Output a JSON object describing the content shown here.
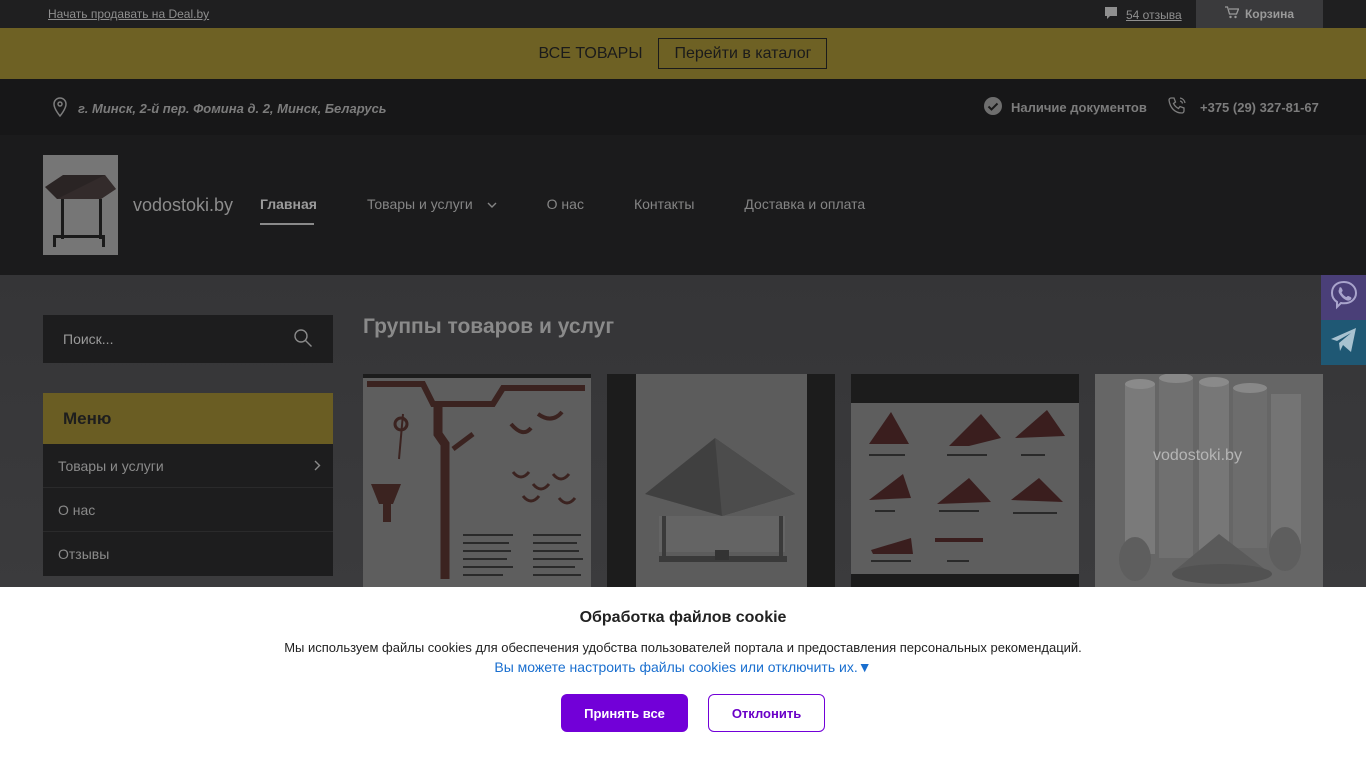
{
  "topbar": {
    "sell_link": "Начать продавать на Deal.by",
    "reviews_label": "54 отзыва",
    "cart_label": "Корзина"
  },
  "promo": {
    "all_goods": "ВСЕ ТОВАРЫ",
    "catalog_button": "Перейти в каталог"
  },
  "infobar": {
    "address": "г. Минск, 2-й пер. Фомина д. 2, Минск, Беларусь",
    "documents": "Наличие документов",
    "phone": "+375 (29) 327-81-67"
  },
  "header": {
    "site_name": "vodostoki.by",
    "nav": [
      {
        "label": "Главная"
      },
      {
        "label": "Товары и услуги"
      },
      {
        "label": "О нас"
      },
      {
        "label": "Контакты"
      },
      {
        "label": "Доставка и оплата"
      }
    ]
  },
  "sidebar": {
    "search_placeholder": "Поиск...",
    "menu_title": "Меню",
    "menu_items": [
      {
        "label": "Товары и услуги"
      },
      {
        "label": "О нас"
      },
      {
        "label": "Отзывы"
      }
    ]
  },
  "main": {
    "title": "Группы товаров и услуг",
    "card4_watermark": "vodostoki.by"
  },
  "cookie": {
    "title": "Обработка файлов cookie",
    "description": "Мы используем файлы cookies для обеспечения удобства пользователей портала и предоставления персональных рекомендаций.",
    "settings_link": "Вы можете настроить файлы cookies или отключить их.▼",
    "accept_label": "Принять все",
    "decline_label": "Отклонить"
  },
  "colors": {
    "accent_gold": "#c9b144",
    "cookie_button": "#7200d8",
    "link_blue": "#1a6fcf"
  }
}
